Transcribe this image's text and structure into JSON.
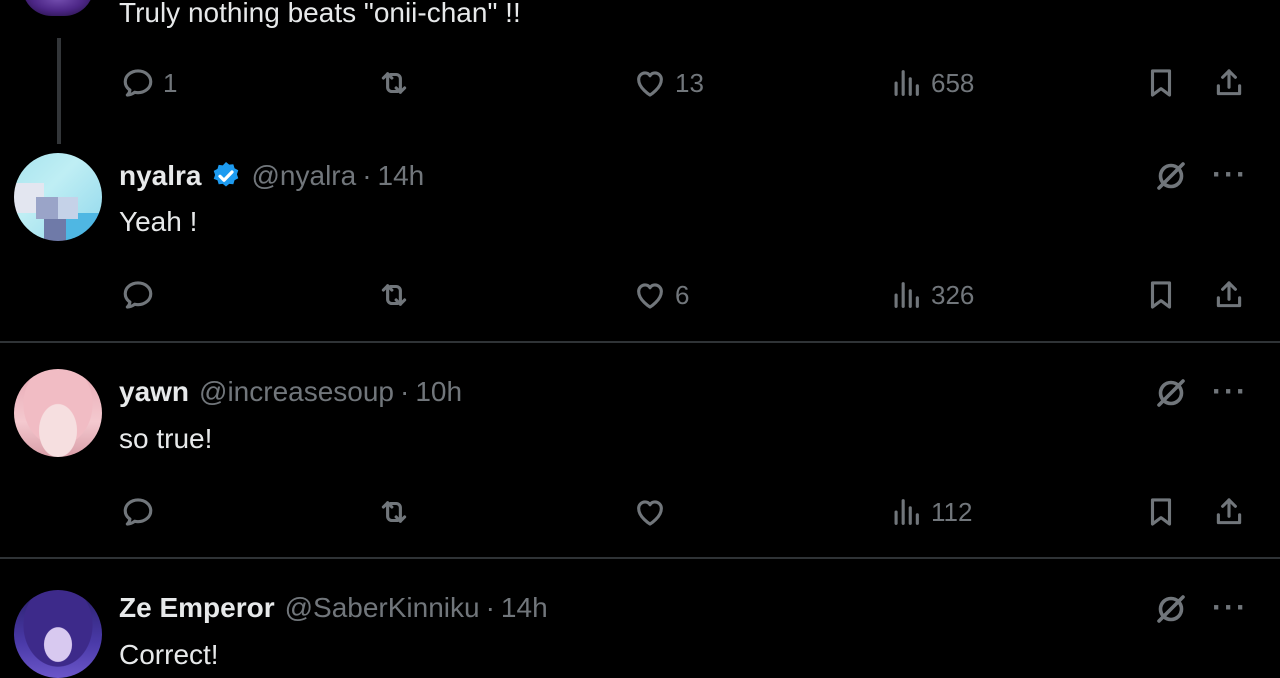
{
  "top_tweet": {
    "text": "Truly nothing beats \"onii-chan\" !!",
    "reply_count": "1",
    "like_count": "13",
    "view_count": "658"
  },
  "replies": [
    {
      "name": "nyalra",
      "handle": "@nyalra",
      "separator": "·",
      "time": "14h",
      "text": "Yeah !",
      "reply_count": "",
      "like_count": "6",
      "view_count": "326",
      "verified": true
    },
    {
      "name": "yawn",
      "handle": "@increasesoup",
      "separator": "·",
      "time": "10h",
      "text": "so true!",
      "reply_count": "",
      "like_count": "",
      "view_count": "112",
      "verified": false
    },
    {
      "name": "Ze Emperor",
      "handle": "@SaberKinniku",
      "separator": "·",
      "time": "14h",
      "text": "Correct!",
      "verified": false
    }
  ],
  "icons": {
    "reply": "reply-icon",
    "retweet": "retweet-icon",
    "like": "heart-icon",
    "views": "views-icon",
    "bookmark": "bookmark-icon",
    "share": "share-icon",
    "grok": "grok-icon",
    "more": "more-icon",
    "verified": "verified-badge-icon"
  },
  "colors": {
    "background": "#000000",
    "text": "#e7e9ea",
    "secondary": "#71767b",
    "divider": "#2f3336",
    "verified": "#1d9bf0"
  },
  "more_glyph": "···"
}
